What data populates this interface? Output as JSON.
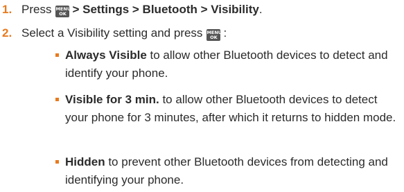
{
  "steps": [
    {
      "number": "1.",
      "prefix": "Press",
      "key": {
        "line1": "MENU",
        "line2": "OK"
      },
      "path": "> Settings > Bluetooth > Visibility",
      "suffix": "."
    },
    {
      "number": "2.",
      "text": "Select a Visibility setting and press",
      "key": {
        "line1": "MENU",
        "line2": "OK"
      },
      "suffix": ":"
    }
  ],
  "options": [
    {
      "name": "Always Visible",
      "description": " to allow other Bluetooth devices to detect and identify your phone."
    },
    {
      "name": "Visible for 3 min.",
      "description": " to allow other Bluetooth devices to detect your phone for 3 minutes, after which it returns to hidden mode."
    },
    {
      "name": "Hidden",
      "description": " to prevent other Bluetooth devices from detecting and identifying your phone."
    }
  ],
  "colors": {
    "accent": "#e87a1e",
    "text": "#2b2b2b",
    "key_bg": "#555555"
  },
  "icons": {
    "menu_key": "menu-ok-key-icon"
  }
}
